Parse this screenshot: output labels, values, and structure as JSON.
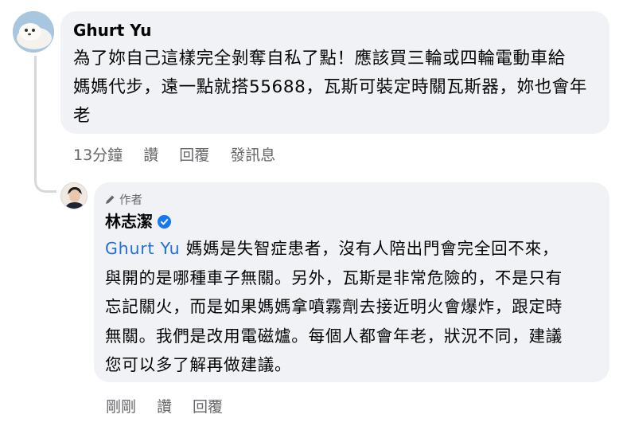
{
  "comment": {
    "author": "Ghurt Yu",
    "text": "為了妳自己這樣完全剝奪自私了點！應該買三輪或四輪電動車給\n媽媽代步，遠一點就搭55688，瓦斯可裝定時關瓦斯器，妳也會年\n老",
    "time": "13分鐘",
    "like_label": "讚",
    "reply_label": "回覆",
    "message_label": "發訊息"
  },
  "reply": {
    "badge": "作者",
    "author": "林志潔",
    "mention": "Ghurt Yu",
    "text": " 媽媽是失智症患者，沒有人陪出門會完全回不來，\n與開的是哪種車子無關。另外，瓦斯是非常危險的，不是只有\n忘記關火，而是如果媽媽拿噴霧劑去接近明火會爆炸，跟定時\n無關。我們是改用電磁爐。每個人都會年老，狀況不同，建議\n您可以多了解再做建議。",
    "time": "剛剛",
    "like_label": "讚",
    "reply_label": "回覆"
  },
  "colors": {
    "bubble": "#f0f2f5",
    "mention": "#216fdb",
    "verified": "#1877f2",
    "meta": "#65676b"
  },
  "icons": [
    "pencil-icon",
    "verified-badge-icon"
  ]
}
